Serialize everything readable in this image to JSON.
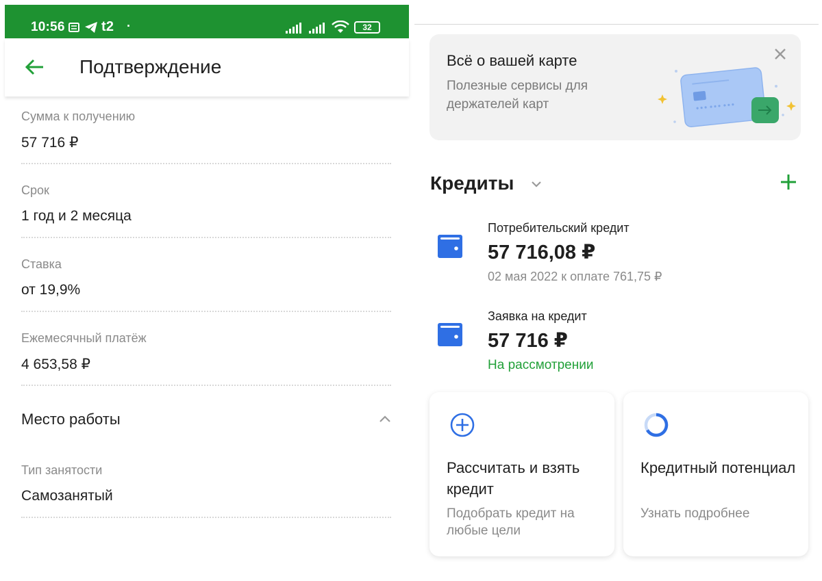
{
  "status_bar": {
    "time": "10:56",
    "carrier": "t2",
    "battery": "32"
  },
  "confirmation": {
    "title": "Подтверждение",
    "fields": [
      {
        "label": "Сумма к получению",
        "value": "57 716 ₽"
      },
      {
        "label": "Срок",
        "value": "1 год и 2 месяца"
      },
      {
        "label": "Ставка",
        "value": "от 19,9%"
      },
      {
        "label": "Ежемесячный платёж",
        "value": "4 653,58 ₽"
      }
    ],
    "work_section": {
      "title": "Место работы",
      "employment_label": "Тип занятости",
      "employment_value": "Самозанятый"
    }
  },
  "promo": {
    "title": "Всё о вашей карте",
    "subtitle": "Полезные сервисы для держателей карт"
  },
  "credits": {
    "title": "Кредиты",
    "items": [
      {
        "name": "Потребительский кредит",
        "amount": "57 716,08 ₽",
        "sub": "02 мая 2022 к оплате 761,75 ₽"
      },
      {
        "name": "Заявка на кредит",
        "amount": "57 716 ₽",
        "status": "На рассмотрении"
      }
    ],
    "cards": [
      {
        "title": "Рассчитать и взять кредит",
        "sub": "Подобрать кредит на любые цели",
        "icon": "plus-circle-icon"
      },
      {
        "title": "Кредитный потенциал",
        "sub": "Узнать подробнее",
        "icon": "progress-ring-icon"
      }
    ]
  },
  "colors": {
    "brand_green": "#1e9231",
    "accent_green": "#21a038",
    "wallet_blue": "#2f6fe4"
  }
}
